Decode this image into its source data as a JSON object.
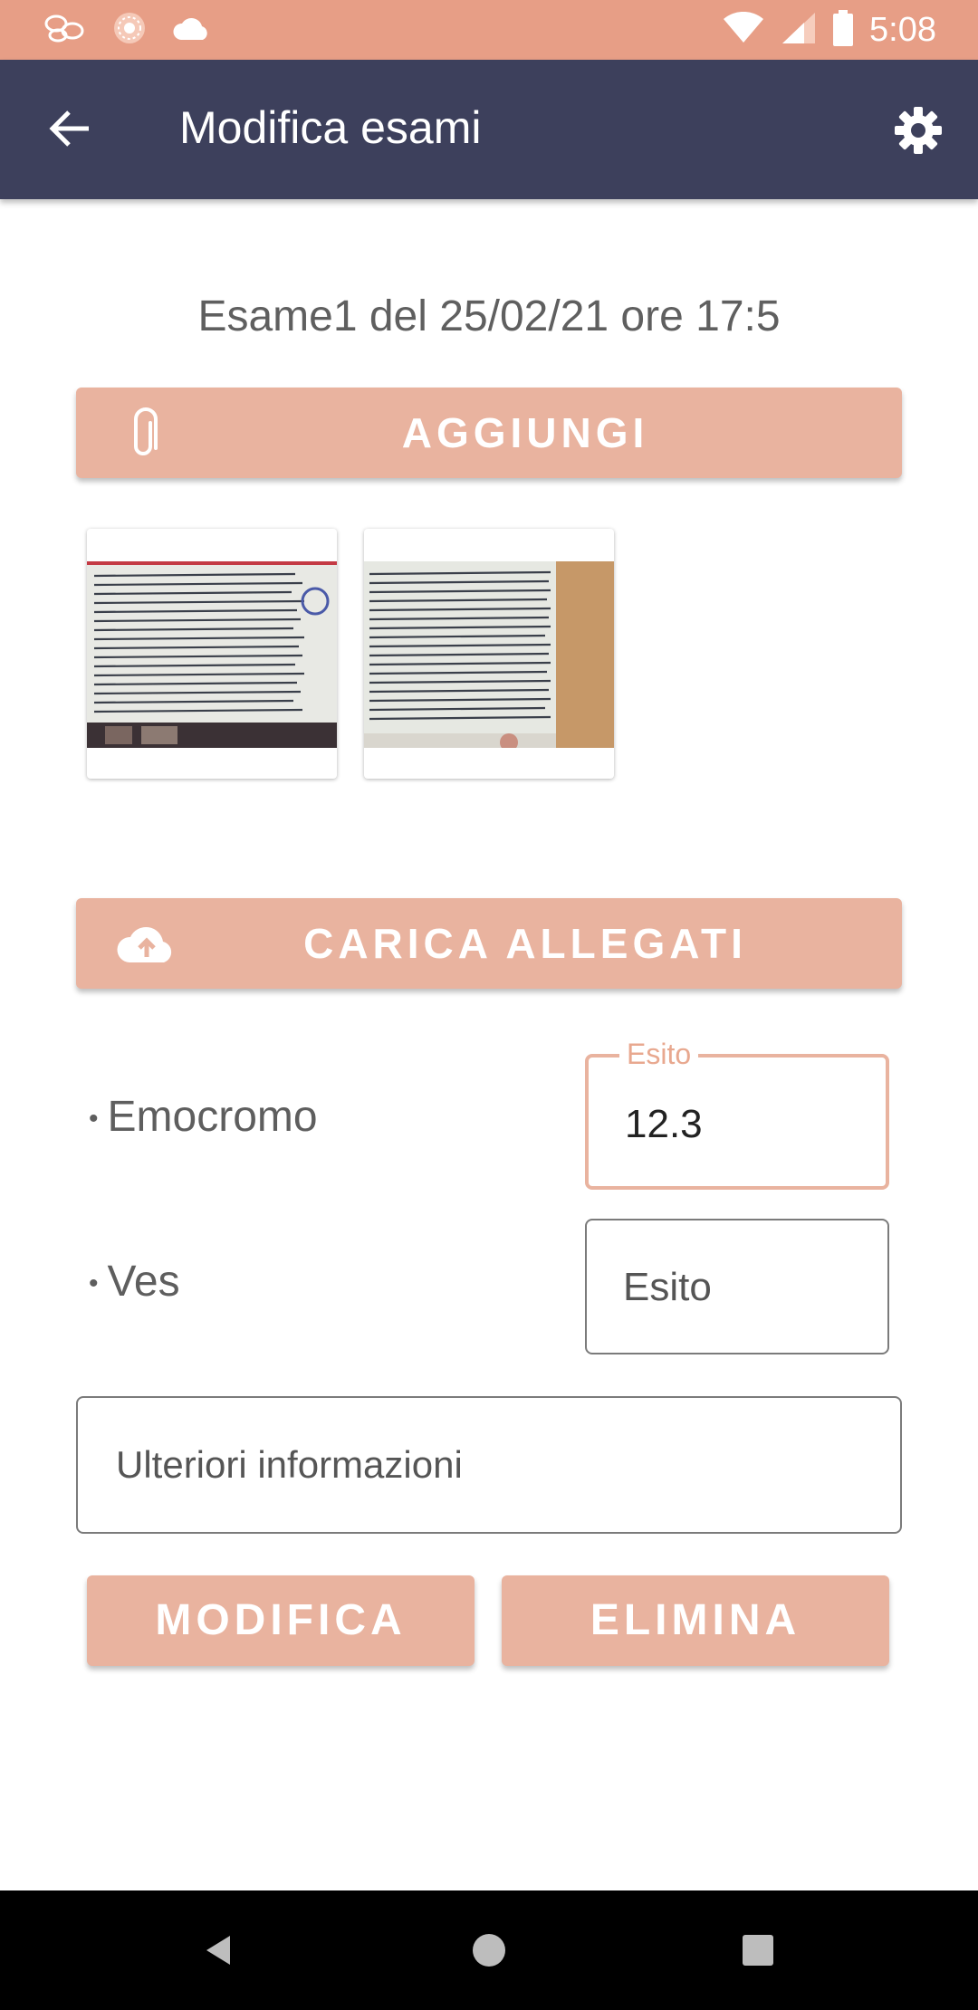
{
  "status_bar": {
    "time": "5:08",
    "icons": [
      "notification-beans-icon",
      "notification-flower-icon",
      "cloud-icon",
      "wifi-icon",
      "signal-icon",
      "battery-icon"
    ]
  },
  "app_bar": {
    "title": "Modifica esami",
    "back_icon": "arrow-back-icon",
    "settings_icon": "gear-icon"
  },
  "exam": {
    "title": "Esame1 del 25/02/21 ore 17:5"
  },
  "buttons": {
    "add_label": "AGGIUNGI",
    "add_icon": "paperclip-icon",
    "upload_label": "CARICA ALLEGATI",
    "upload_icon": "cloud-upload-icon",
    "edit_label": "MODIFICA",
    "delete_label": "ELIMINA"
  },
  "attachments": [
    {
      "name": "attachment-1"
    },
    {
      "name": "attachment-2"
    }
  ],
  "results": [
    {
      "label": "Emocromo",
      "field_label": "Esito",
      "value": "12.3",
      "placeholder": "Esito"
    },
    {
      "label": "Ves",
      "field_label": "Esito",
      "value": "",
      "placeholder": "Esito"
    }
  ],
  "notes": {
    "placeholder": "Ulteriori informazioni",
    "value": ""
  },
  "colors": {
    "status_bar": "#e79e86",
    "app_bar": "#3d405c",
    "accent": "#e9b39f",
    "nav_bar": "#000000"
  }
}
